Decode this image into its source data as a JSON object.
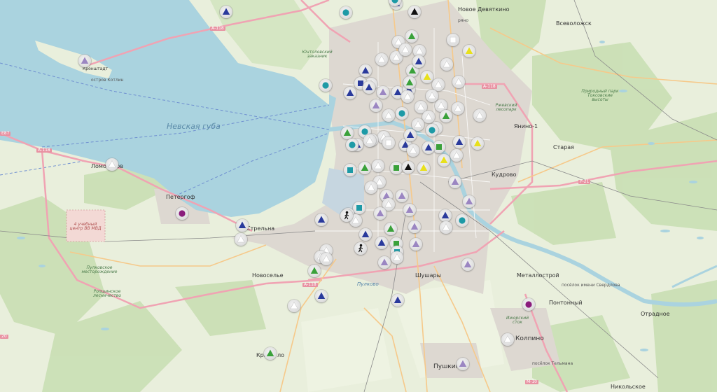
{
  "colors": {
    "water": "#aad3df",
    "land": "#e9efdc",
    "forest": "#c9dfb4",
    "urban": "#dcd7d0",
    "road_primary": "#f7a8b8",
    "road_secondary": "#f9d38b",
    "marker_bg": "#e6e6e6"
  },
  "labels": {
    "gulf": "Невская губа",
    "kronstadt": "Кронштадт",
    "kotlin": "остров Котлин",
    "a118_n": "А-118",
    "a118_w": "А-118",
    "a118_s": "А-118",
    "a118_e": "А-118",
    "r21": "Р-21",
    "m10": "М-10",
    "e87": "Е87",
    "lomonosov": "Ломоносов",
    "peterhof": "Петергоф",
    "strelna": "Стрельна",
    "novoselye": "Новоселье",
    "shushary": "Шушары",
    "pushkin": "Пушкин",
    "kolpino": "Колпино",
    "metallostroy": "Металлострой",
    "pontonny": "Понтонный",
    "otradnoe": "Отрадное",
    "vsevolozhsk": "Всеволожск",
    "yanino": "Янино-1",
    "staraya": "Старая",
    "kudrovo": "Кудрово",
    "novoe_devyatkino": "Новое Девяткино",
    "devyatkino_r": "ряно",
    "nikolskoe": "Никольское",
    "telmana": "посёлок Тельмана",
    "sverdlova": "посёлок имени Свердлова",
    "krasnoe": "Кра",
    "krasnoe_b": "ло",
    "pulkovo": "Пулково",
    "yuntolovo": "Юнтоловский заказник",
    "nature_park": "Природный парк Токсовские высоты",
    "military": "4 учебный центр ВВ МВД",
    "rzhevsky": "Ржевский лесопарк",
    "izhora": "Ижорский сток",
    "lenin_pond": "Пулковское месторождение",
    "lake_forest": "Ропшинское лесничество",
    "e20": "20"
  },
  "markers": [
    {
      "icon": "triangle",
      "color": "navy"
    },
    {
      "icon": "dot",
      "color": "teal"
    },
    {
      "icon": "triangle",
      "color": "black"
    },
    {
      "icon": "triangle",
      "color": "navy"
    },
    {
      "icon": "dot",
      "color": "teal"
    },
    {
      "icon": "triangle",
      "color": "white"
    },
    {
      "icon": "triangle",
      "color": "green"
    },
    {
      "icon": "triangle",
      "color": "yellow"
    },
    {
      "icon": "square",
      "color": "white"
    },
    {
      "icon": "triangle",
      "color": "white"
    },
    {
      "icon": "triangle",
      "color": "white"
    },
    {
      "icon": "triangle",
      "color": "yellow"
    },
    {
      "icon": "triangle",
      "color": "white"
    },
    {
      "icon": "triangle",
      "color": "green"
    },
    {
      "icon": "triangle",
      "color": "white"
    },
    {
      "icon": "dot",
      "color": "teal"
    },
    {
      "icon": "triangle",
      "color": "white"
    },
    {
      "icon": "triangle",
      "color": "white"
    },
    {
      "icon": "square",
      "color": "navy"
    },
    {
      "icon": "triangle",
      "color": "navy"
    },
    {
      "icon": "triangle",
      "color": "lavender"
    },
    {
      "icon": "triangle",
      "color": "navy"
    },
    {
      "icon": "triangle",
      "color": "navy"
    },
    {
      "icon": "triangle",
      "color": "white"
    },
    {
      "icon": "triangle",
      "color": "lavender"
    },
    {
      "icon": "triangle",
      "color": "white"
    },
    {
      "icon": "dot",
      "color": "teal"
    },
    {
      "icon": "triangle",
      "color": "white"
    },
    {
      "icon": "triangle",
      "color": "white"
    },
    {
      "icon": "triangle",
      "color": "green"
    },
    {
      "icon": "triangle",
      "color": "white"
    },
    {
      "icon": "triangle",
      "color": "white"
    },
    {
      "icon": "triangle",
      "color": "white"
    },
    {
      "icon": "triangle",
      "color": "green"
    },
    {
      "icon": "dot",
      "color": "teal"
    },
    {
      "icon": "triangle",
      "color": "white"
    },
    {
      "icon": "square",
      "color": "white"
    },
    {
      "icon": "triangle",
      "color": "navy"
    },
    {
      "icon": "triangle",
      "color": "white"
    },
    {
      "icon": "triangle",
      "color": "yellow"
    },
    {
      "icon": "triangle",
      "color": "navy"
    },
    {
      "icon": "square",
      "color": "green"
    },
    {
      "icon": "triangle",
      "color": "white"
    },
    {
      "icon": "dot",
      "color": "teal"
    },
    {
      "icon": "triangle",
      "color": "navy"
    },
    {
      "icon": "triangle",
      "color": "navy"
    },
    {
      "icon": "triangle",
      "color": "green"
    },
    {
      "icon": "triangle",
      "color": "yellow"
    },
    {
      "icon": "square",
      "color": "teal"
    },
    {
      "icon": "triangle",
      "color": "white"
    },
    {
      "icon": "square",
      "color": "green"
    },
    {
      "icon": "triangle",
      "color": "black"
    },
    {
      "icon": "triangle",
      "color": "yellow"
    },
    {
      "icon": "triangle",
      "color": "white"
    },
    {
      "icon": "triangle",
      "color": "white"
    },
    {
      "icon": "triangle",
      "color": "white"
    },
    {
      "icon": "triangle",
      "color": "lavender"
    },
    {
      "icon": "triangle",
      "color": "lavender"
    },
    {
      "icon": "triangle",
      "color": "white"
    },
    {
      "icon": "square",
      "color": "teal"
    },
    {
      "icon": "triangle",
      "color": "navy"
    },
    {
      "icon": "triangle",
      "color": "lavender"
    },
    {
      "icon": "triangle",
      "color": "lavender"
    },
    {
      "icon": "triangle",
      "color": "white"
    },
    {
      "icon": "pedestrian",
      "color": "black"
    },
    {
      "icon": "triangle",
      "color": "navy"
    },
    {
      "icon": "dot",
      "color": "teal"
    },
    {
      "icon": "triangle",
      "color": "white"
    },
    {
      "icon": "triangle",
      "color": "navy"
    },
    {
      "icon": "triangle",
      "color": "green"
    },
    {
      "icon": "triangle",
      "color": "lavender"
    },
    {
      "icon": "triangle",
      "color": "lavender"
    },
    {
      "icon": "triangle",
      "color": "navy"
    },
    {
      "icon": "triangle",
      "color": "navy"
    },
    {
      "icon": "pedestrian",
      "color": "black"
    },
    {
      "icon": "triangle",
      "color": "white"
    },
    {
      "icon": "triangle",
      "color": "white"
    },
    {
      "icon": "square",
      "color": "green"
    },
    {
      "icon": "triangle",
      "color": "lavender"
    },
    {
      "icon": "square",
      "color": "teal"
    },
    {
      "icon": "triangle",
      "color": "white"
    },
    {
      "icon": "triangle",
      "color": "lavender"
    },
    {
      "icon": "triangle",
      "color": "lavender"
    },
    {
      "icon": "triangle",
      "color": "green"
    },
    {
      "icon": "triangle",
      "color": "white"
    },
    {
      "icon": "triangle",
      "color": "navy"
    },
    {
      "icon": "triangle",
      "color": "navy"
    },
    {
      "icon": "triangle",
      "color": "lavender"
    },
    {
      "icon": "triangle",
      "color": "white"
    },
    {
      "icon": "triangle",
      "color": "navy"
    },
    {
      "icon": "triangle",
      "color": "white"
    },
    {
      "icon": "dot",
      "color": "purple"
    },
    {
      "icon": "dot",
      "color": "purple"
    },
    {
      "icon": "triangle",
      "color": "white"
    },
    {
      "icon": "triangle",
      "color": "lavender"
    },
    {
      "icon": "triangle",
      "color": "green"
    },
    {
      "icon": "triangle",
      "color": "white"
    },
    {
      "icon": "triangle",
      "color": "lavender"
    },
    {
      "icon": "triangle",
      "color": "white"
    },
    {
      "icon": "triangle",
      "color": "navy"
    },
    {
      "icon": "triangle",
      "color": "white"
    },
    {
      "icon": "triangle",
      "color": "white"
    },
    {
      "icon": "triangle",
      "color": "navy"
    },
    {
      "icon": "triangle",
      "color": "green"
    },
    {
      "icon": "triangle",
      "color": "navy"
    },
    {
      "icon": "triangle",
      "color": "white"
    },
    {
      "icon": "triangle",
      "color": "navy"
    },
    {
      "icon": "triangle",
      "color": "white"
    },
    {
      "icon": "dot",
      "color": "teal"
    },
    {
      "icon": "triangle",
      "color": "white"
    }
  ]
}
